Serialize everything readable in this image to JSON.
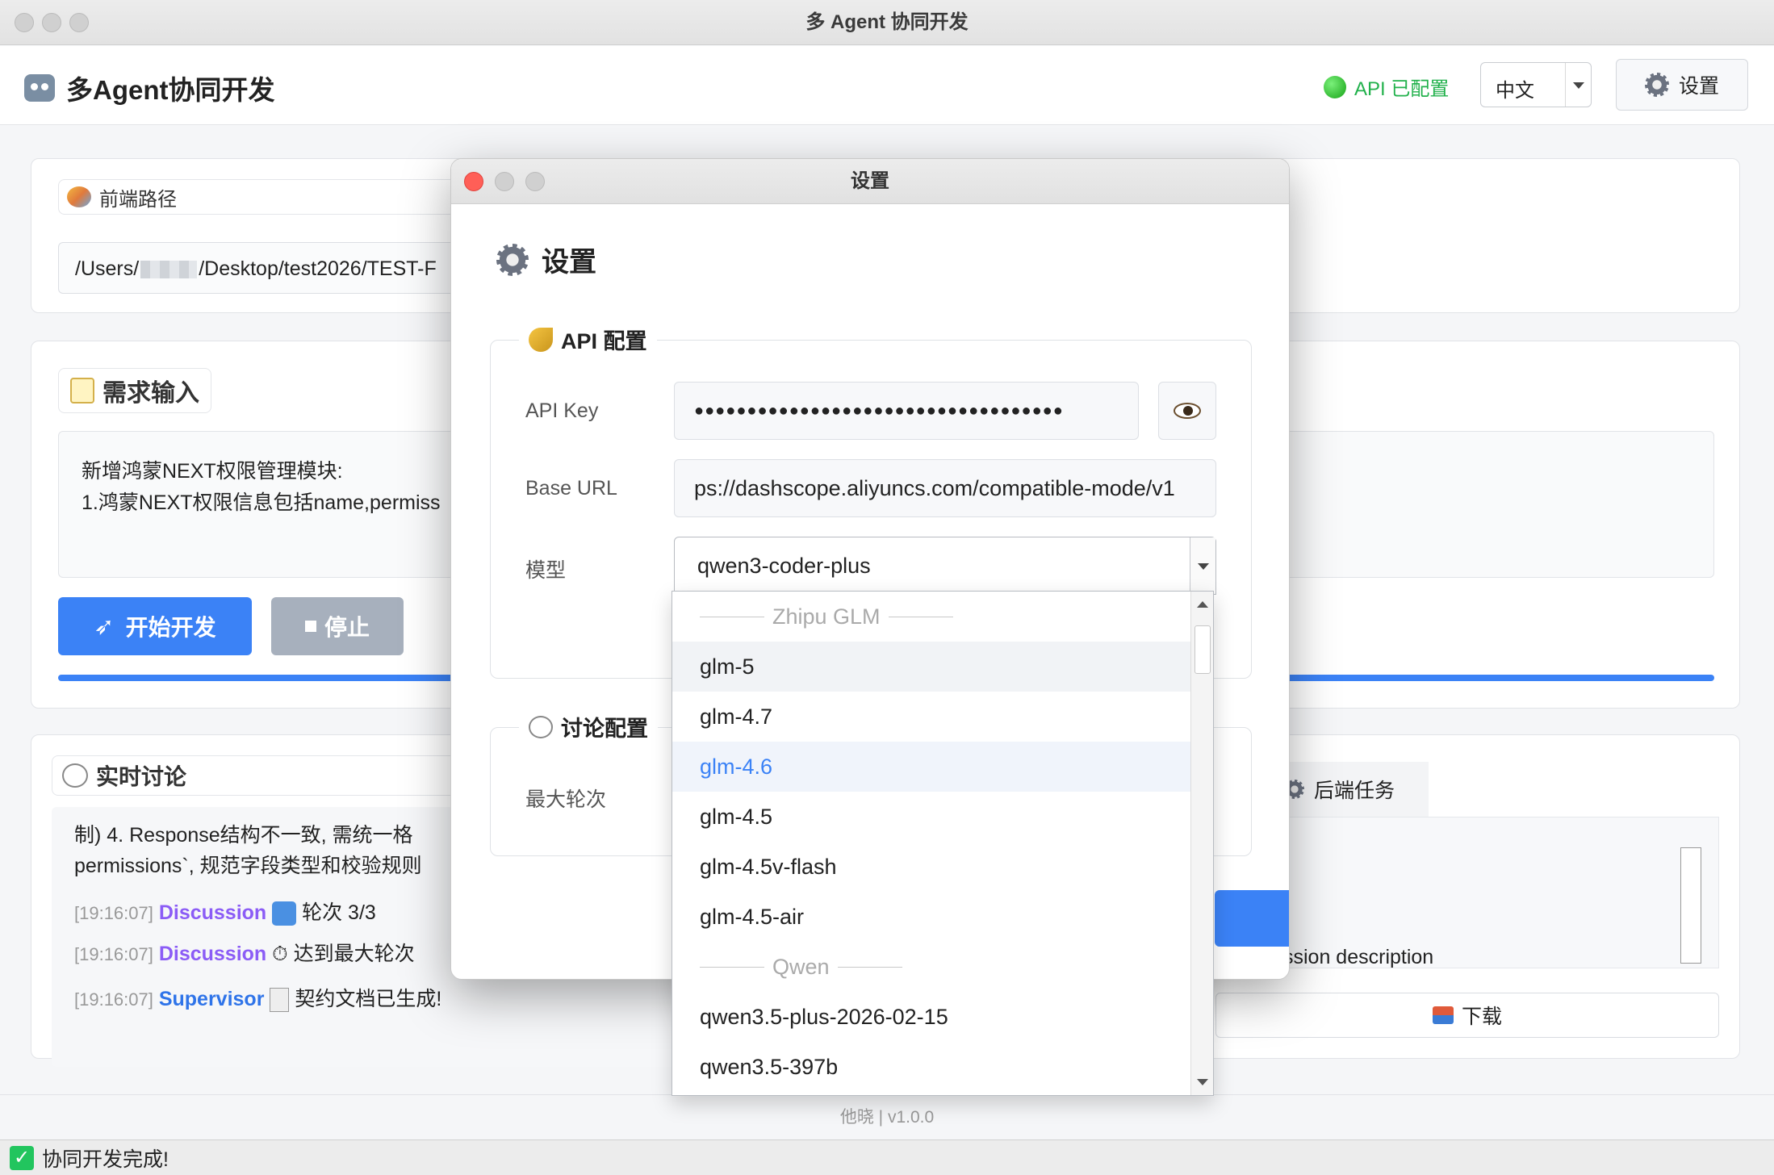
{
  "window": {
    "title": "多 Agent 协同开发"
  },
  "header": {
    "app_title": "多Agent协同开发",
    "api_status": "API 已配置",
    "language": "中文",
    "settings_label": "设置"
  },
  "frontend": {
    "legend": "前端路径",
    "path_prefix": "/Users/",
    "path_suffix": "/Desktop/test2026/TEST-F"
  },
  "requirement": {
    "legend": "需求输入",
    "line1": "新增鸿蒙NEXT权限管理模块:",
    "line2": "1.鸿蒙NEXT权限信息包括name,permiss",
    "start_label": "开始开发",
    "stop_label": "停止"
  },
  "discussion": {
    "legend": "实时讨论",
    "text1": "制) 4. Response结构不一致, 需统一格",
    "text2": "permissions`, 规范字段类型和校验规则",
    "logs": [
      {
        "time": "[19:16:07]",
        "who": "Discussion",
        "msg": "轮次 3/3"
      },
      {
        "time": "[19:16:07]",
        "who": "Discussion",
        "msg": "达到最大轮次"
      },
      {
        "time": "[19:16:07]",
        "who": "Supervisor",
        "msg": "契约文档已生成!"
      }
    ]
  },
  "backend": {
    "tab_label": "后端任务",
    "partial_text": "ssion description",
    "download_label": "下载"
  },
  "footer": {
    "text": "他晓 | v1.0.0"
  },
  "statusbar": {
    "text": "协同开发完成!"
  },
  "dialog": {
    "title": "设置",
    "heading": "设置",
    "api_section": "API 配置",
    "api_key_label": "API Key",
    "api_key_value": "●●●●●●●●●●●●●●●●●●●●●●●●●●●●●●●●●●●",
    "base_url_label": "Base URL",
    "base_url_value": "ps://dashscope.aliyuncs.com/compatible-mode/v1",
    "model_label": "模型",
    "model_value": "qwen3-coder-plus",
    "discussion_section": "讨论配置",
    "max_rounds_label": "最大轮次"
  },
  "model_dropdown": {
    "group_zhipu": "Zhipu GLM",
    "group_qwen": "Qwen",
    "items": [
      "glm-5",
      "glm-4.7",
      "glm-4.6",
      "glm-4.5",
      "glm-4.5v-flash",
      "glm-4.5-air",
      "qwen3.5-plus-2026-02-15",
      "qwen3.5-397b"
    ],
    "hover_item": "glm-5",
    "selected_item": "glm-4.6"
  },
  "colors": {
    "accent": "#3b82f6",
    "success": "#22b14c",
    "discussion": "#8b5cf6",
    "supervisor": "#2f74e9"
  }
}
